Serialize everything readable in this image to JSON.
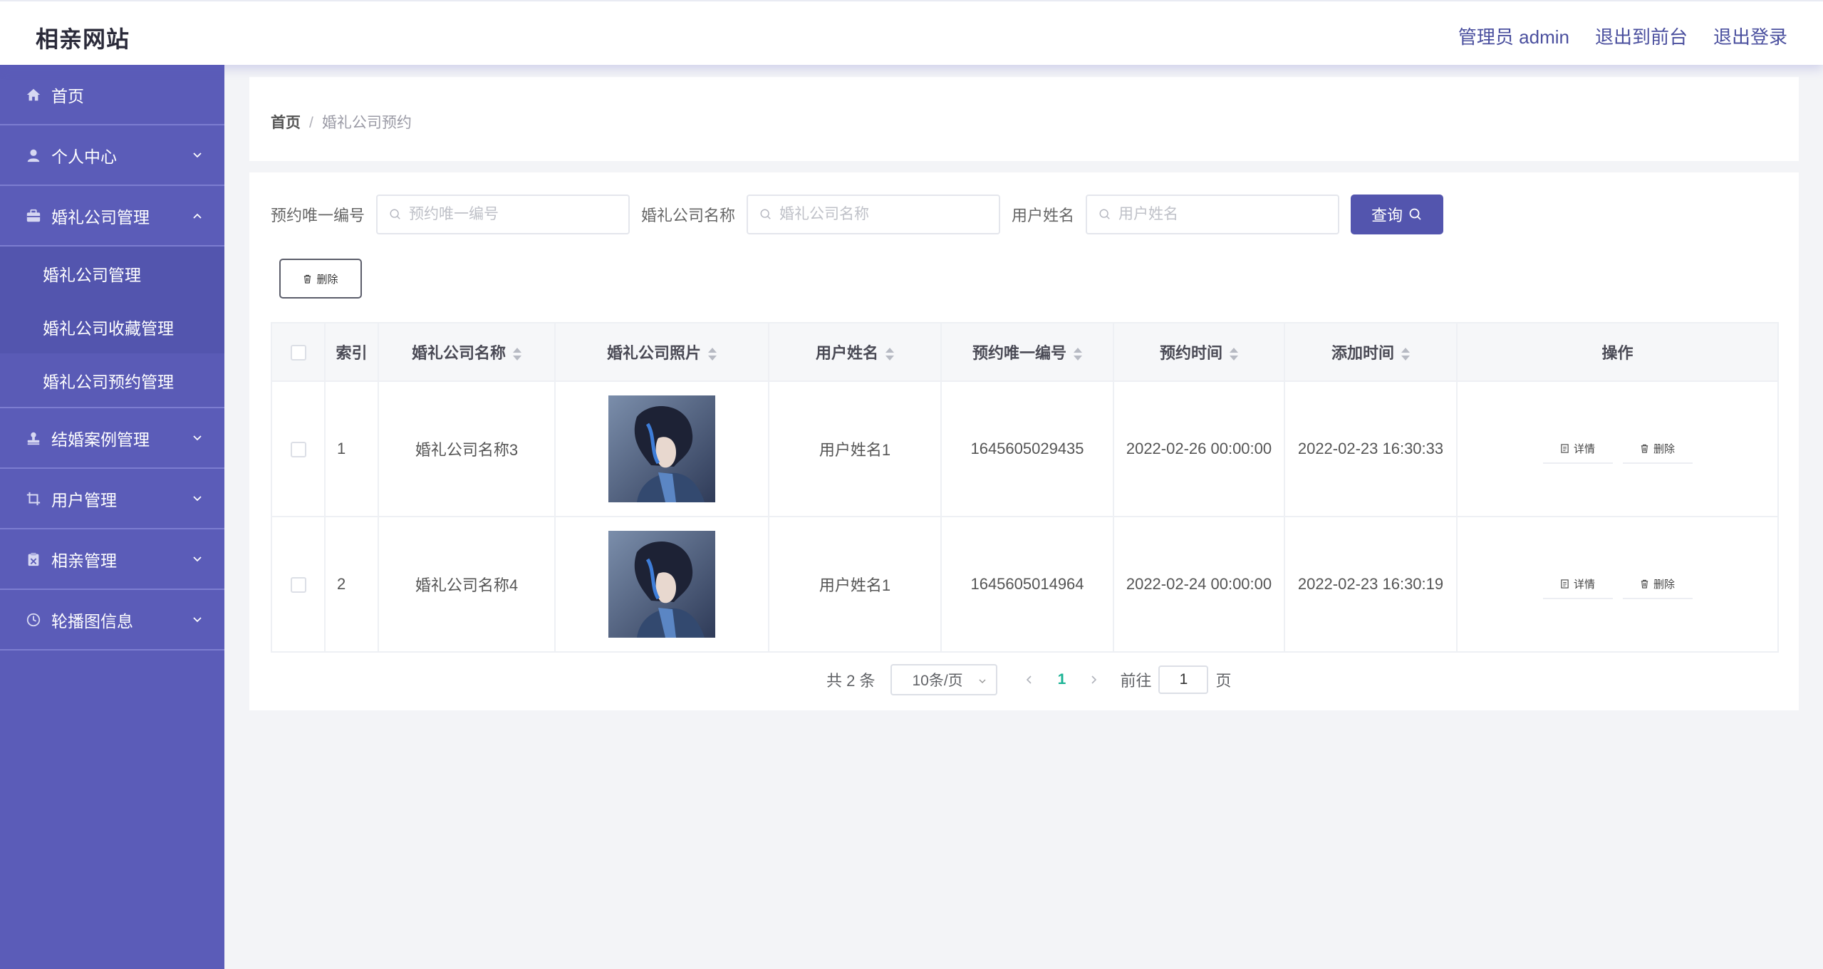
{
  "header": {
    "brand": "相亲网站",
    "admin_label": "管理员 admin",
    "front_link": "退出到前台",
    "logout_link": "退出登录"
  },
  "sidebar": {
    "items": [
      {
        "label": "首页",
        "icon": "home-icon"
      },
      {
        "label": "个人中心",
        "icon": "user-icon"
      },
      {
        "label": "婚礼公司管理",
        "icon": "briefcase-icon",
        "expanded": true,
        "children": [
          "婚礼公司管理",
          "婚礼公司收藏管理",
          "婚礼公司预约管理"
        ]
      },
      {
        "label": "结婚案例管理",
        "icon": "stamp-icon"
      },
      {
        "label": "用户管理",
        "icon": "crop-icon"
      },
      {
        "label": "相亲管理",
        "icon": "clipboard-icon"
      },
      {
        "label": "轮播图信息",
        "icon": "clock-icon"
      }
    ]
  },
  "breadcrumb": {
    "home": "首页",
    "separator": "/",
    "current": "婚礼公司预约"
  },
  "filters": {
    "booking_no_label": "预约唯一编号",
    "booking_no_placeholder": "预约唯一编号",
    "company_label": "婚礼公司名称",
    "company_placeholder": "婚礼公司名称",
    "user_label": "用户姓名",
    "user_placeholder": "用户姓名",
    "query_button": "查询"
  },
  "toolbar": {
    "delete_button": "删除"
  },
  "table": {
    "headers": [
      "索引",
      "婚礼公司名称",
      "婚礼公司照片",
      "用户姓名",
      "预约唯一编号",
      "预约时间",
      "添加时间",
      "操作"
    ],
    "rows": [
      {
        "index": "1",
        "company": "婚礼公司名称3",
        "user": "用户姓名1",
        "booking_no": "1645605029435",
        "booking_time": "2022-02-26 00:00:00",
        "added_time": "2022-02-23 16:30:33"
      },
      {
        "index": "2",
        "company": "婚礼公司名称4",
        "user": "用户姓名1",
        "booking_no": "1645605014964",
        "booking_time": "2022-02-24 00:00:00",
        "added_time": "2022-02-23 16:30:19"
      }
    ],
    "detail_button": "详情",
    "row_delete_button": "删除"
  },
  "pagination": {
    "total": "共 2 条",
    "page_size": "10条/页",
    "current_page": "1",
    "goto_label": "前往",
    "goto_value": "1",
    "page_suffix": "页"
  },
  "colors": {
    "sidebar": "#5b5cb8",
    "accent": "#5355ae",
    "active_page": "#1ab394"
  }
}
